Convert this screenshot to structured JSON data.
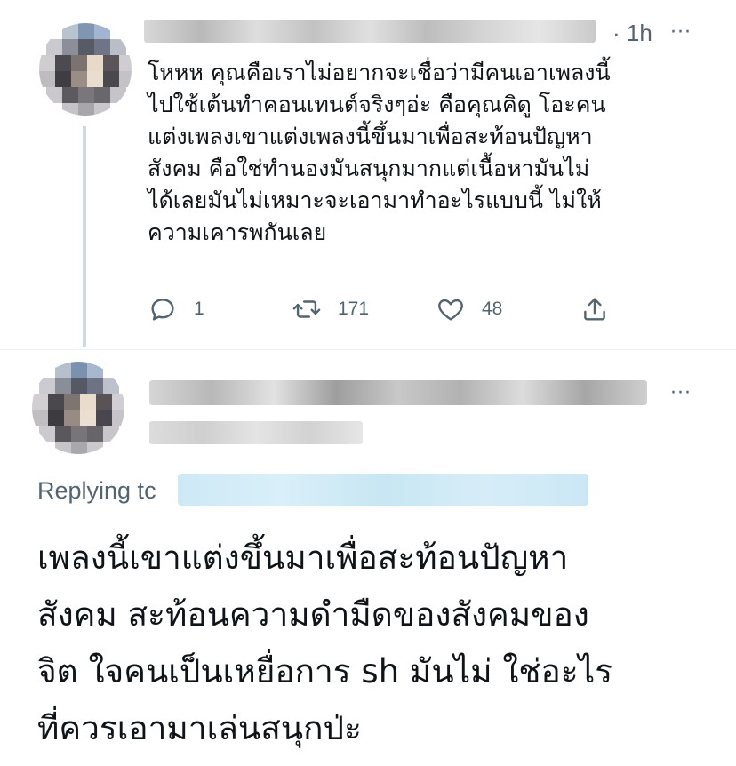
{
  "tweet": {
    "time": "· 1h",
    "more": "···",
    "text": "โหหห คุณคือเราไม่อยากจะเชื่อว่ามีคนเอาเพลงนี้\nไปใช้เต้นทำคอนเทนต์จริงๆอ่ะ คือคุณคิดู โอะคน\nแต่งเพลงเขาแต่งเพลงนี้ขึ้นมาเพื่อสะท้อนปัญหา\nสังคม คือใช่ทำนองมันสนุกมากแต่เนื้อหามันไม่\nได้เลยมันไม่เหมาะจะเอามาทำอะไรแบบนี้ ไม่ให้\nความเคารพกันเลย",
    "actions": {
      "reply_count": "1",
      "retweet_count": "171",
      "like_count": "48"
    },
    "icons": [
      "reply-icon",
      "retweet-icon",
      "like-icon",
      "share-icon"
    ]
  },
  "reply": {
    "more": "···",
    "replying_label": "Replying tc",
    "text": "เพลงนี้เขาแต่งขึ้นมาเพื่อสะท้อนปัญหา\nสังคม สะท้อนความดำมืดของสังคมของ\nจิต ใจคนเป็นเหยื่อการ sh มันไม่ ใช่อะไร\nที่ควรเอามาเล่นสนุกป่ะ"
  },
  "colors": {
    "text": "#0f1419",
    "secondary": "#536471",
    "thread_line": "#cfd9de",
    "mention_blur": "#cde9f6"
  }
}
